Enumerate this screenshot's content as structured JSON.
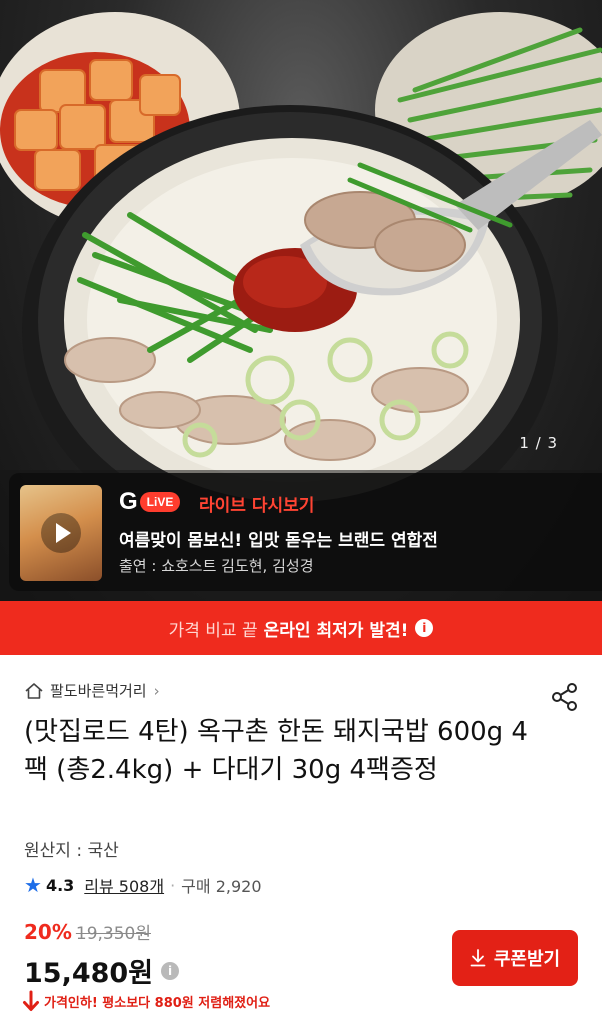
{
  "hero": {
    "image_counter": "1 / 3"
  },
  "live": {
    "logo_letter": "G",
    "logo_badge": "LiVE",
    "tag": "라이브 다시보기",
    "title": "여름맞이 몸보신! 입맛 돋우는 브랜드 연합전",
    "cast": "출연 : 쇼호스트 김도현, 김성경"
  },
  "promo": {
    "text_light": "가격 비교 끝",
    "text_bold": "온라인 최저가 발견!",
    "info_icon": "i"
  },
  "product": {
    "store_name": "팔도바른먹거리",
    "store_chevron": "›",
    "title": "(맛집로드 4탄) 옥구촌 한돈 돼지국밥 600g 4팩 (총2.4kg) + 다대기 30g 4팩증정",
    "origin": "원산지 : 국산",
    "rating": "4.3",
    "review_label": "리뷰 508개",
    "dot": "·",
    "purchase_label": "구매 2,920",
    "discount": "20%",
    "original_price": "19,350원",
    "price": "15,480원",
    "price_info_icon": "i",
    "coupon_label": "쿠폰받기",
    "price_drop_notice": "가격인하! 평소보다 880원 저렴해졌어요"
  },
  "colors": {
    "accent_red": "#ef2b1e",
    "rating_star": "#1d6de8"
  },
  "icons": {
    "home": "home-icon",
    "share": "share-icon",
    "star": "star-icon",
    "download": "download-icon",
    "price_down": "arrow-down-icon"
  }
}
